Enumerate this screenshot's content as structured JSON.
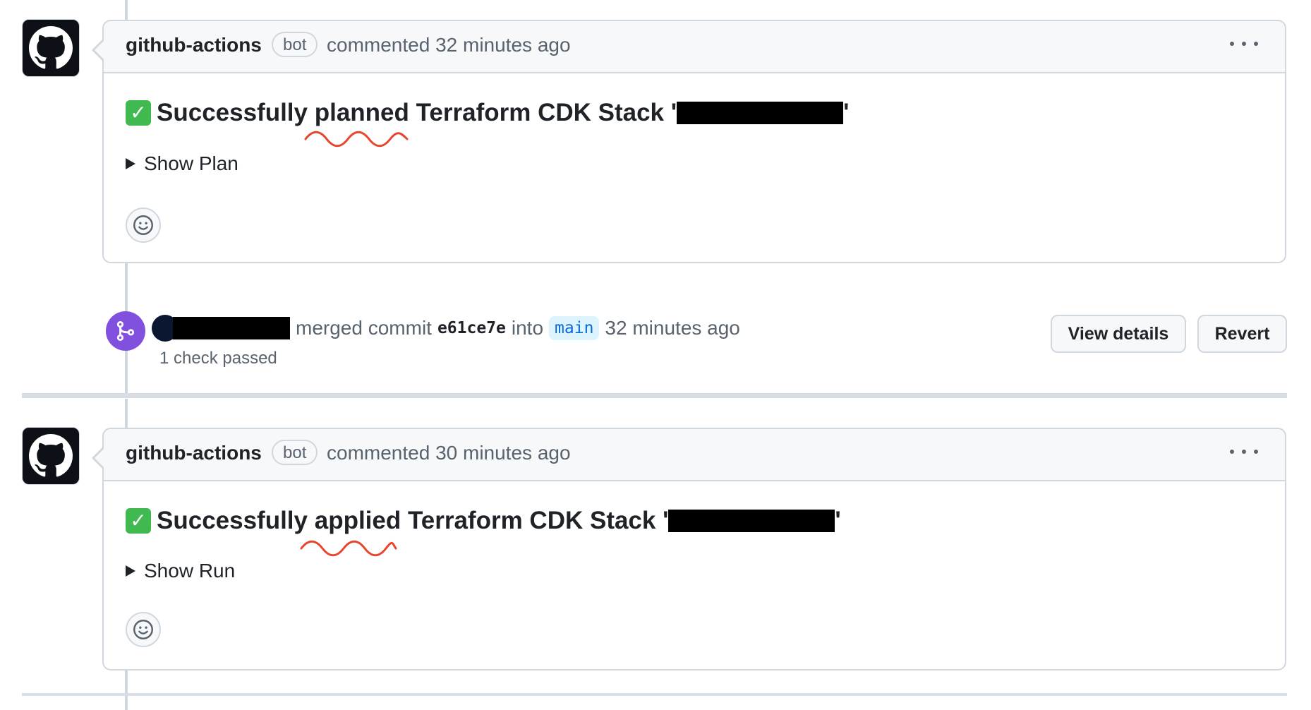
{
  "comments": [
    {
      "author": "github-actions",
      "badge": "bot",
      "action": "commented 32 minutes ago",
      "headline_emoji": "✓",
      "headline": "Successfully planned Terraform CDK Stack '",
      "headline_end": "'",
      "details_summary": "Show Plan",
      "menu_icon": "kebab-horizontal-icon",
      "avatar_icon": "github-octocat-icon"
    },
    {
      "author": "github-actions",
      "badge": "bot",
      "action": "commented 30 minutes ago",
      "headline_emoji": "✓",
      "headline": "Successfully applied Terraform CDK Stack '",
      "headline_end": "'",
      "details_summary": "Show Run",
      "menu_icon": "kebab-horizontal-icon",
      "avatar_icon": "github-octocat-icon"
    }
  ],
  "merge_event": {
    "text_merged": "merged commit",
    "commit_sha": "e61ce7e",
    "text_into": "into",
    "branch": "main",
    "time": "32 minutes ago",
    "checks": "1 check passed",
    "view_details_label": "View details",
    "revert_label": "Revert",
    "icon": "git-merge-icon"
  },
  "colors": {
    "merge_purple": "#8250df",
    "border": "#d0d7de",
    "header_bg": "#f6f8fa",
    "branch_blue": "#0969da",
    "annotation_red": "#e8452c",
    "success_green": "#3fb950"
  }
}
